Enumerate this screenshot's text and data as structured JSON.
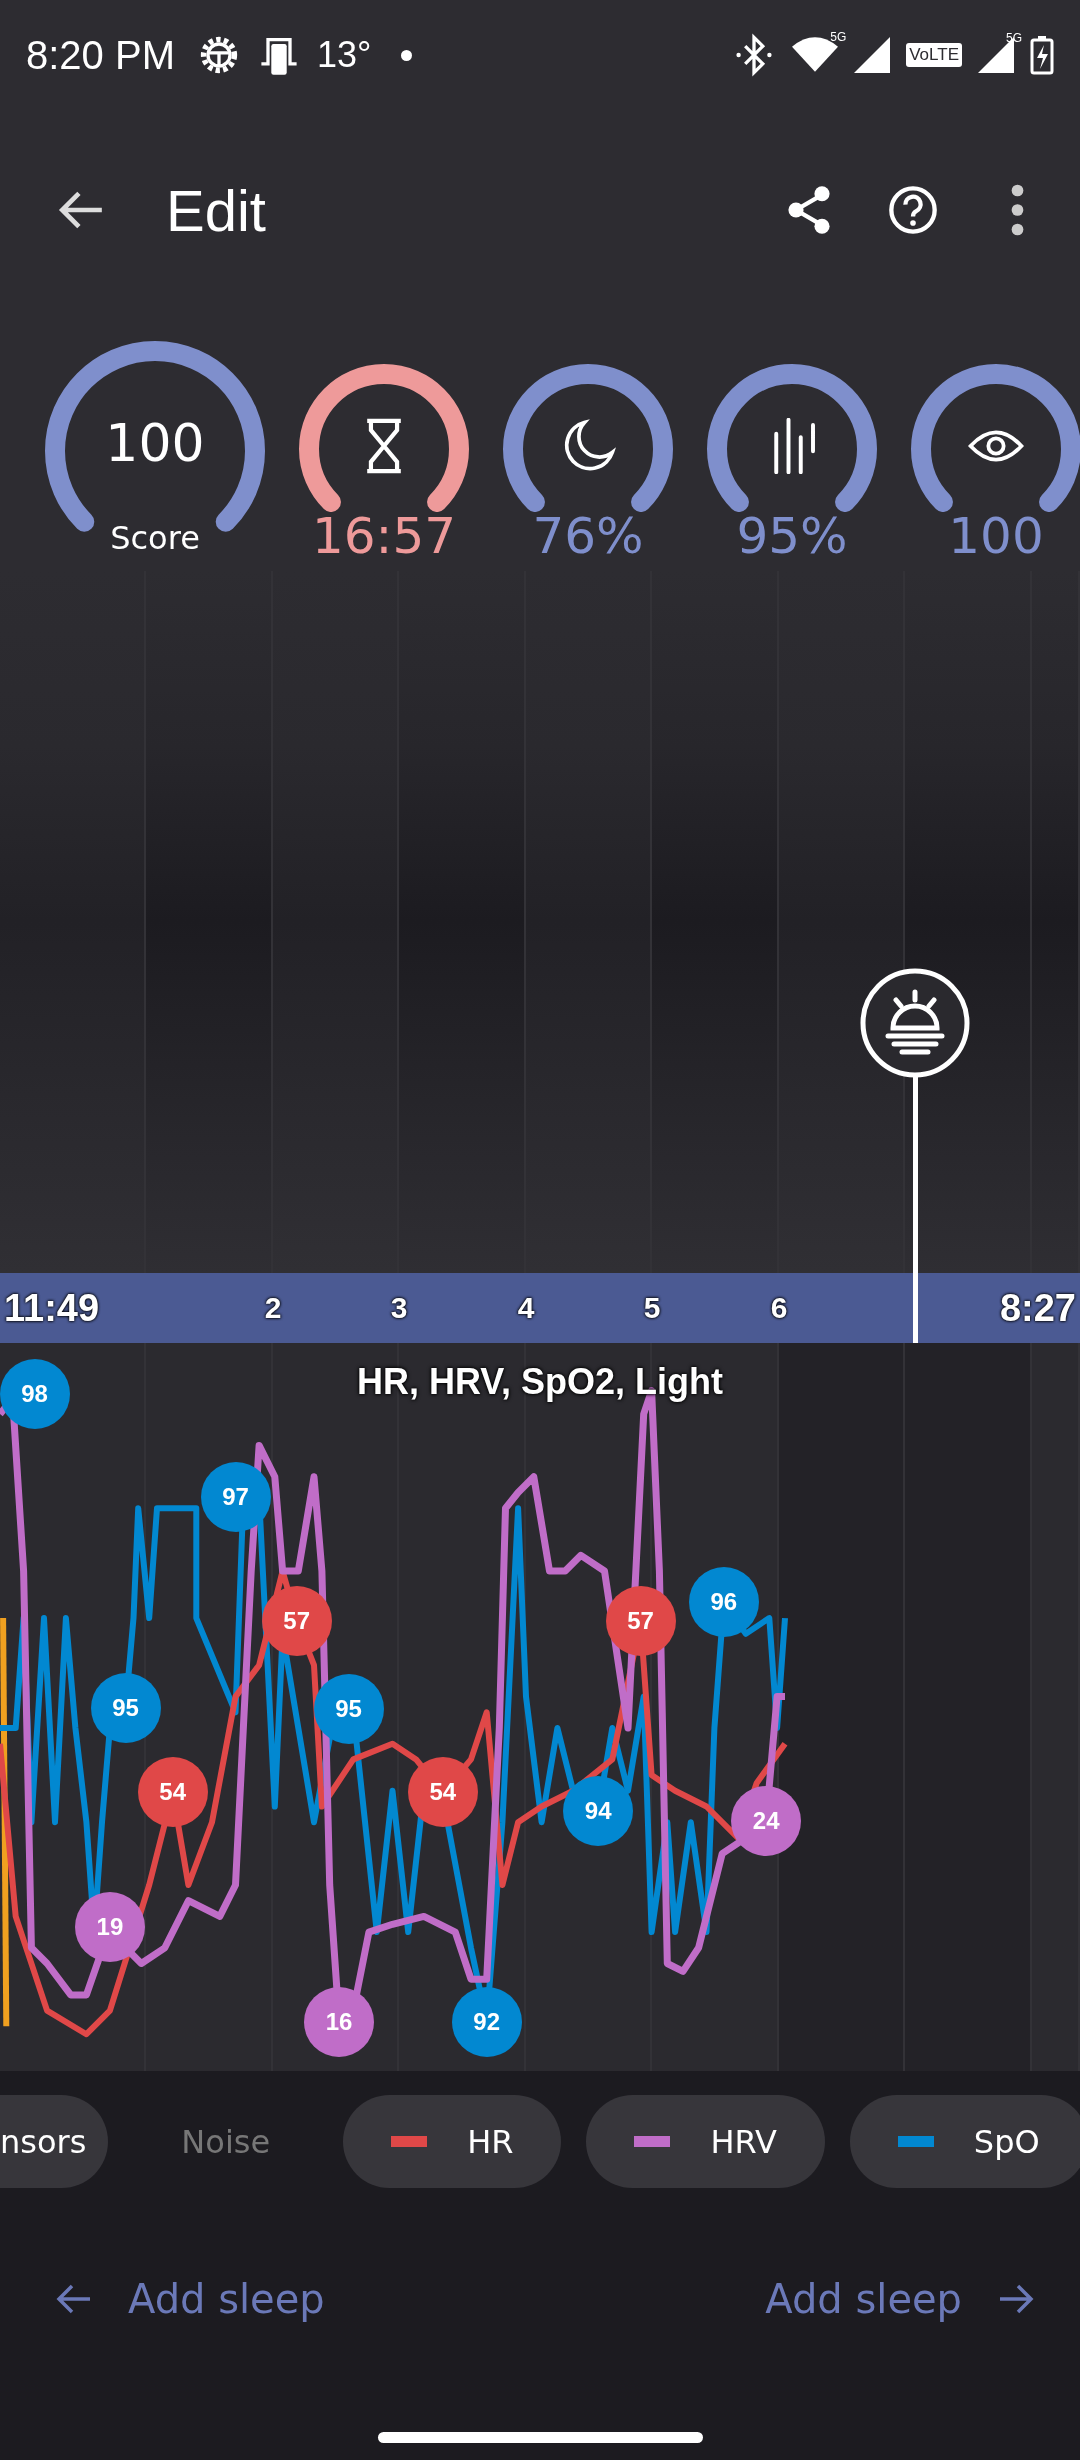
{
  "status_bar": {
    "time": "8:20 PM",
    "temperature": "13°",
    "wifi_badge": "5G",
    "volte_label": "VoLTE",
    "signal_badge": "5G"
  },
  "app_bar": {
    "title": "Edit"
  },
  "gauges": [
    {
      "kind": "score",
      "value": "100",
      "label": "Score",
      "color": "#7f8fcc"
    },
    {
      "kind": "duration",
      "value": "16:57",
      "color": "#ee9a9a"
    },
    {
      "kind": "sleep",
      "value": "76%",
      "color": "#7f8fcc"
    },
    {
      "kind": "noise",
      "value": "95%",
      "color": "#7f8fcc"
    },
    {
      "kind": "awake",
      "value": "100",
      "color": "#7f8fcc"
    }
  ],
  "timeline": {
    "start": "11:49",
    "hours": [
      "2",
      "3",
      "4",
      "5",
      "6"
    ],
    "end": "8:27"
  },
  "chart": {
    "title": "HR, HRV, SpO2, Light",
    "markers": [
      {
        "value": "98",
        "color": "#0288d1"
      },
      {
        "value": "97",
        "color": "#0288d1"
      },
      {
        "value": "57",
        "color": "#e04848"
      },
      {
        "value": "95",
        "color": "#0288d1"
      },
      {
        "value": "95",
        "color": "#0288d1"
      },
      {
        "value": "54",
        "color": "#e04848"
      },
      {
        "value": "54",
        "color": "#e04848"
      },
      {
        "value": "19",
        "color": "#c06dc8"
      },
      {
        "value": "16",
        "color": "#c06dc8"
      },
      {
        "value": "92",
        "color": "#0288d1"
      },
      {
        "value": "94",
        "color": "#0288d1"
      },
      {
        "value": "57",
        "color": "#e04848"
      },
      {
        "value": "96",
        "color": "#0288d1"
      },
      {
        "value": "24",
        "color": "#c06dc8"
      }
    ]
  },
  "chips": [
    {
      "label": "nsors",
      "selected": true
    },
    {
      "label": "Noise",
      "selected": false
    },
    {
      "label": "HR",
      "selected": true,
      "color": "#e04848"
    },
    {
      "label": "HRV",
      "selected": true,
      "color": "#c06dc8"
    },
    {
      "label": "SpO",
      "selected": true,
      "color": "#0288d1"
    }
  ],
  "footer": {
    "previous": "Add sleep",
    "next": "Add sleep"
  }
}
